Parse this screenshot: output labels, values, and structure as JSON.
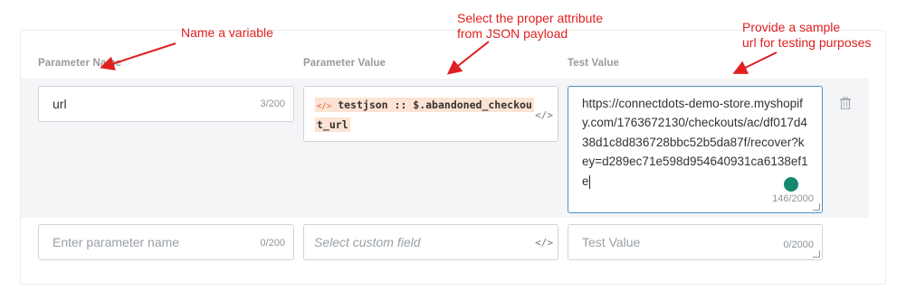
{
  "headers": {
    "name": "Parameter Name",
    "value": "Parameter Value",
    "test": "Test Value"
  },
  "row1": {
    "name_value": "url",
    "name_counter": "3/200",
    "value_prefix": "testjson :: $.abandoned_checkou",
    "value_suffix": "t_url",
    "value_code_icon": "</>",
    "tag_icon": "</>",
    "test_value": "https://connectdots-demo-store.myshopify.com/1763672130/checkouts/ac/df017d438d1c8d836728bbc52b5da87f/recover?key=d289ec71e598d954640931ca6138ef1e",
    "test_counter": "146/2000"
  },
  "row2": {
    "name_placeholder": "Enter parameter name",
    "name_counter": "0/200",
    "value_placeholder": "Select custom field",
    "value_code_icon": "</>",
    "test_placeholder": "Test Value",
    "test_counter": "0/2000"
  },
  "annotations": {
    "name": "Name a variable",
    "value_line1": "Select the proper attribute",
    "value_line2": "from JSON payload",
    "test_line1": "Provide a sample",
    "test_line2": "url for testing purposes"
  },
  "colors": {
    "annotation": "#e02020",
    "active_border": "#4a90c2",
    "tag_highlight": "#fde3d3",
    "row_background": "#f4f5f7"
  },
  "icons": {
    "delete": "trash-icon",
    "code": "code-icon",
    "grammar": "grammarly-icon"
  }
}
